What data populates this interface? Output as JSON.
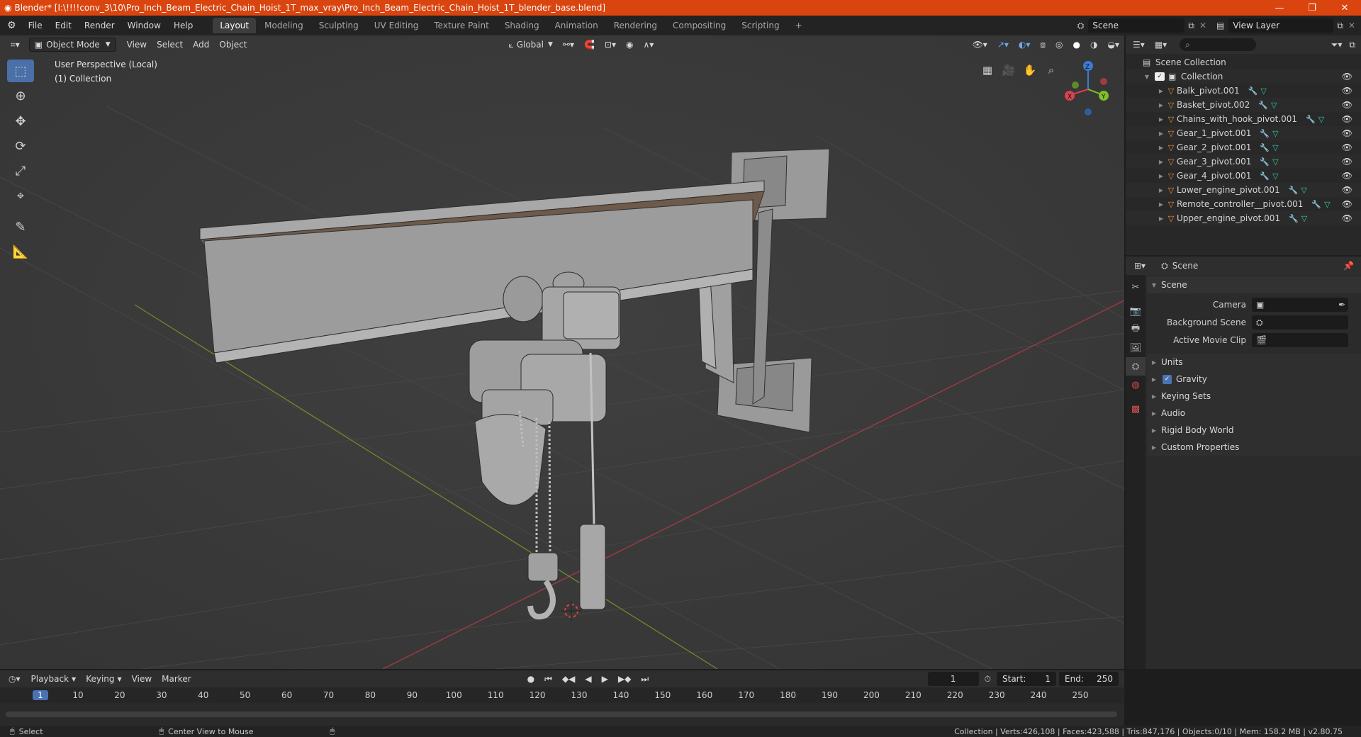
{
  "titlebar": {
    "title": "Blender* [I:\\!!!!conv_3\\10\\Pro_Inch_Beam_Electric_Chain_Hoist_1T_max_vray\\Pro_Inch_Beam_Electric_Chain_Hoist_1T_blender_base.blend]",
    "minimize": "—",
    "maximize": "❐",
    "close": "✕"
  },
  "menubar": {
    "menus": [
      "File",
      "Edit",
      "Render",
      "Window",
      "Help"
    ],
    "workspaces": [
      "Layout",
      "Modeling",
      "Sculpting",
      "UV Editing",
      "Texture Paint",
      "Shading",
      "Animation",
      "Rendering",
      "Compositing",
      "Scripting"
    ],
    "add_workspace": "+",
    "scene": "Scene",
    "view_layer": "View Layer"
  },
  "viewport": {
    "mode": "Object Mode",
    "menus": [
      "View",
      "Select",
      "Add",
      "Object"
    ],
    "orientation": "Global",
    "info_line1": "User Perspective (Local)",
    "info_line2": "(1) Collection",
    "gizmo": {
      "x": "X",
      "y": "Y",
      "z": "Z"
    }
  },
  "outliner": {
    "root": "Scene Collection",
    "collection": "Collection",
    "objects": [
      "Balk_pivot.001",
      "Basket_pivot.002",
      "Chains_with_hook_pivot.001",
      "Gear_1_pivot.001",
      "Gear_2_pivot.001",
      "Gear_3_pivot.001",
      "Gear_4_pivot.001",
      "Lower_engine_pivot.001",
      "Remote_controller__pivot.001",
      "Upper_engine_pivot.001"
    ]
  },
  "properties": {
    "header": "Scene",
    "panel": "Scene",
    "camera_label": "Camera",
    "background_scene_label": "Background Scene",
    "active_movie_clip_label": "Active Movie Clip",
    "sections": [
      "Units",
      "Gravity",
      "Keying Sets",
      "Audio",
      "Rigid Body World",
      "Custom Properties"
    ]
  },
  "timeline": {
    "menus": [
      "Playback",
      "Keying",
      "View",
      "Marker"
    ],
    "current_frame": "1",
    "start_label": "Start:",
    "start": "1",
    "end_label": "End:",
    "end": "250",
    "ticks": [
      "1",
      "10",
      "20",
      "30",
      "40",
      "50",
      "60",
      "70",
      "80",
      "90",
      "100",
      "110",
      "120",
      "130",
      "140",
      "150",
      "160",
      "170",
      "180",
      "190",
      "200",
      "210",
      "220",
      "230",
      "240",
      "250"
    ]
  },
  "statusbar": {
    "left": "Select",
    "middle": "Center View to Mouse",
    "right": "Collection | Verts:426,108 | Faces:423,588 | Tris:847,176 | Objects:0/10 | Mem: 158.2 MB | v2.80.75"
  }
}
